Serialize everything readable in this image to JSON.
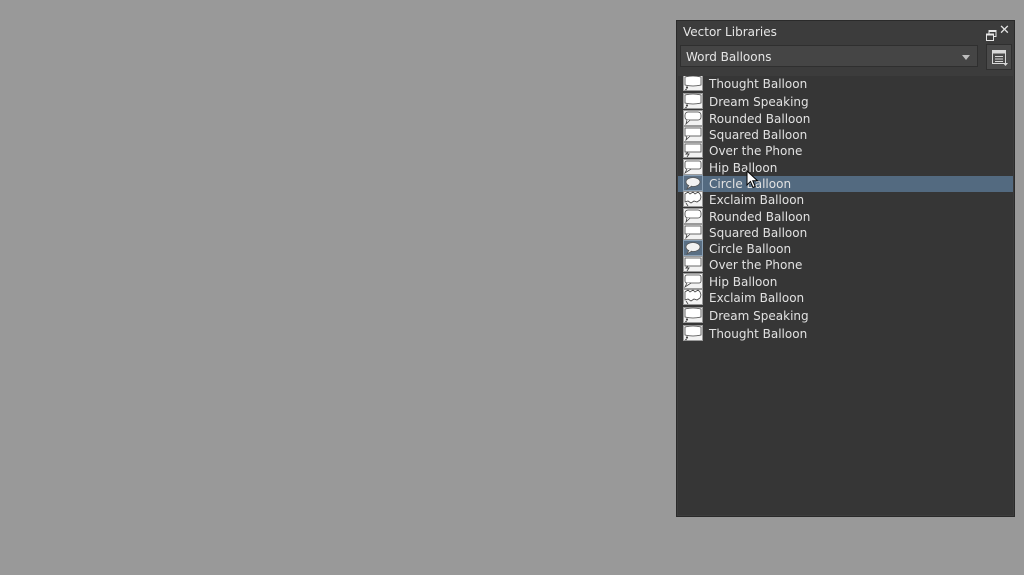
{
  "docker": {
    "title": "Vector Libraries",
    "library_selected": "Word Balloons"
  },
  "items": [
    {
      "label": "Thought Balloon",
      "icon": "thought-balloon-icon",
      "selected": false
    },
    {
      "label": "Dream Speaking",
      "icon": "dream-speaking-icon",
      "selected": false
    },
    {
      "label": "Rounded Balloon",
      "icon": "rounded-balloon-icon",
      "selected": false
    },
    {
      "label": "Squared Balloon",
      "icon": "squared-balloon-icon",
      "selected": false
    },
    {
      "label": "Over the Phone",
      "icon": "over-the-phone-icon",
      "selected": false
    },
    {
      "label": "Hip Balloon",
      "icon": "hip-balloon-icon",
      "selected": false
    },
    {
      "label": "Circle Balloon",
      "icon": "circle-balloon-icon",
      "selected": true
    },
    {
      "label": "Exclaim Balloon",
      "icon": "exclaim-balloon-icon",
      "selected": false
    },
    {
      "label": "Rounded Balloon",
      "icon": "rounded-balloon-icon",
      "selected": false
    },
    {
      "label": "Squared Balloon",
      "icon": "squared-balloon-icon",
      "selected": false
    },
    {
      "label": "Circle Balloon",
      "icon": "circle-balloon-icon",
      "selected": false
    },
    {
      "label": "Over the Phone",
      "icon": "over-the-phone-icon",
      "selected": false
    },
    {
      "label": "Hip Balloon",
      "icon": "hip-balloon-icon",
      "selected": false
    },
    {
      "label": "Exclaim Balloon",
      "icon": "exclaim-balloon-icon",
      "selected": false
    },
    {
      "label": "Dream Speaking",
      "icon": "dream-speaking-icon",
      "selected": false
    },
    {
      "label": "Thought Balloon",
      "icon": "thought-balloon-icon",
      "selected": false
    }
  ],
  "colors": {
    "canvas": "#999999",
    "panel": "#3c3c3c",
    "list": "#363636",
    "selection": "#536a80",
    "text": "#e2e2e2"
  }
}
